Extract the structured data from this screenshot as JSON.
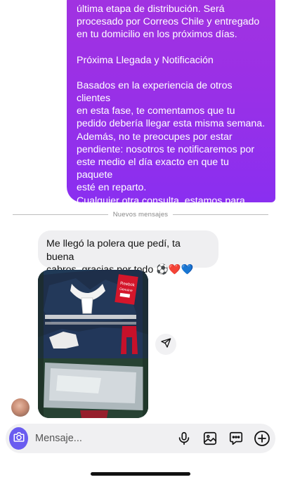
{
  "outgoing_message": {
    "paragraphs": [
      "última etapa de distribución. Será\nprocesado por Correos Chile y entregado\nen tu domicilio en los próximos días.",
      "Próxima Llegada y Notificación",
      "Basados en la experiencia de otros clientes\nen esta fase, te comentamos que tu\npedido debería llegar esta misma semana.\nAdemás, no te preocupes por estar\npendiente: nosotros te notificaremos por\neste medio el día exacto en que tu paquete\nesté en reparto.\nCualquier otra consulta, estamos para\nayudarte.\nSaludos."
    ]
  },
  "divider": {
    "label": "Nuevos mensajes"
  },
  "incoming_message": {
    "text": "Me llegó la polera que pedí, ta buena\ncabros, gracias por todo ⚽️❤️💙"
  },
  "photo": {
    "tag_text": [
      "Reebok",
      "Genuine"
    ]
  },
  "composer": {
    "placeholder": "Mensaje..."
  },
  "icons": {
    "camera": "camera-icon",
    "mic": "microphone-icon",
    "gallery": "image-icon",
    "sticker": "sticker-icon",
    "add": "plus-icon",
    "share": "send-icon"
  },
  "colors": {
    "accent": "#6a5cf0",
    "outgoing_bubble": "#9a30e6",
    "incoming_bubble": "#efeff1"
  }
}
